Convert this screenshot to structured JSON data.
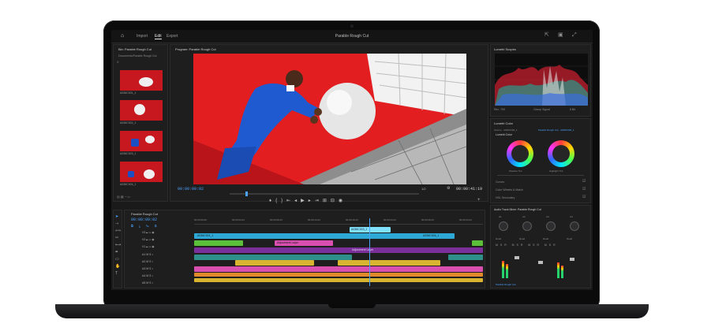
{
  "topbar": {
    "nav": [
      "Import",
      "Edit",
      "Export"
    ],
    "active_nav": "Edit",
    "title": "Parable Rough Cut",
    "icons": [
      "home-icon",
      "share-icon",
      "workspace-icon",
      "fullscreen-icon"
    ]
  },
  "project": {
    "tab": "Bin: Parable Rough Cut",
    "path": "Documents/Parable Rough Cut",
    "clips": [
      "A036C001_1",
      "A036C002_1",
      "A036C003_1",
      "A036C004_1"
    ]
  },
  "program": {
    "tab": "Program: Parable Rough Cut",
    "timecode_left": "00:00:09:02",
    "fraction": "1/2",
    "timecode_right": "00:00:41:19"
  },
  "timeline": {
    "tab": "Parable Rough Cut",
    "timecode": "00:00:09:02",
    "ruler": [
      "00:00:00:00",
      "00:00:04:23",
      "00:00:09:23",
      "00:00:14:23",
      "00:00:19:23",
      "00:00:24:23",
      "00:00:29:23",
      "00:00:34:23"
    ],
    "tracks": [
      "V3",
      "V2",
      "V1",
      "A1",
      "A2",
      "A3",
      "A4",
      "A5"
    ],
    "clip_labels": [
      "A036C003_1",
      "A036C001_1",
      "A036C004_1",
      "Adjustment Layer",
      "Adjustment Layer",
      "Lumetri"
    ]
  },
  "scopes": {
    "tab": "Lumetri Scopes",
    "options": [
      "Rec. 709",
      "Clamp Signal",
      "8 Bit"
    ]
  },
  "lumetri": {
    "tab": "Lumetri Color",
    "source": "Source · A036C002_1",
    "target": "Parable Rough Cut · A036C002_1",
    "section": "Lumetri Color",
    "wheels": [
      "Shadow Tint",
      "Highlight Tint"
    ],
    "rows": [
      "Curves",
      "Color Wheels & Match",
      "HSL Secondary"
    ]
  },
  "mixer": {
    "tab": "Audio Track Mixer: Parable Rough Cut",
    "channels": [
      "A1",
      "A2",
      "A3",
      "A4"
    ],
    "read": "Read",
    "footer": "Parable Rough Cut"
  },
  "colors": {
    "accent": "#4aa3ff",
    "clip_blue": "#2ea8d6",
    "clip_pink": "#d94fb0",
    "clip_purple": "#7a2f9a",
    "clip_green": "#5bbf3a",
    "clip_yellow": "#d8b431",
    "clip_orange": "#e08a2c",
    "clip_teal": "#2f8f8a"
  }
}
